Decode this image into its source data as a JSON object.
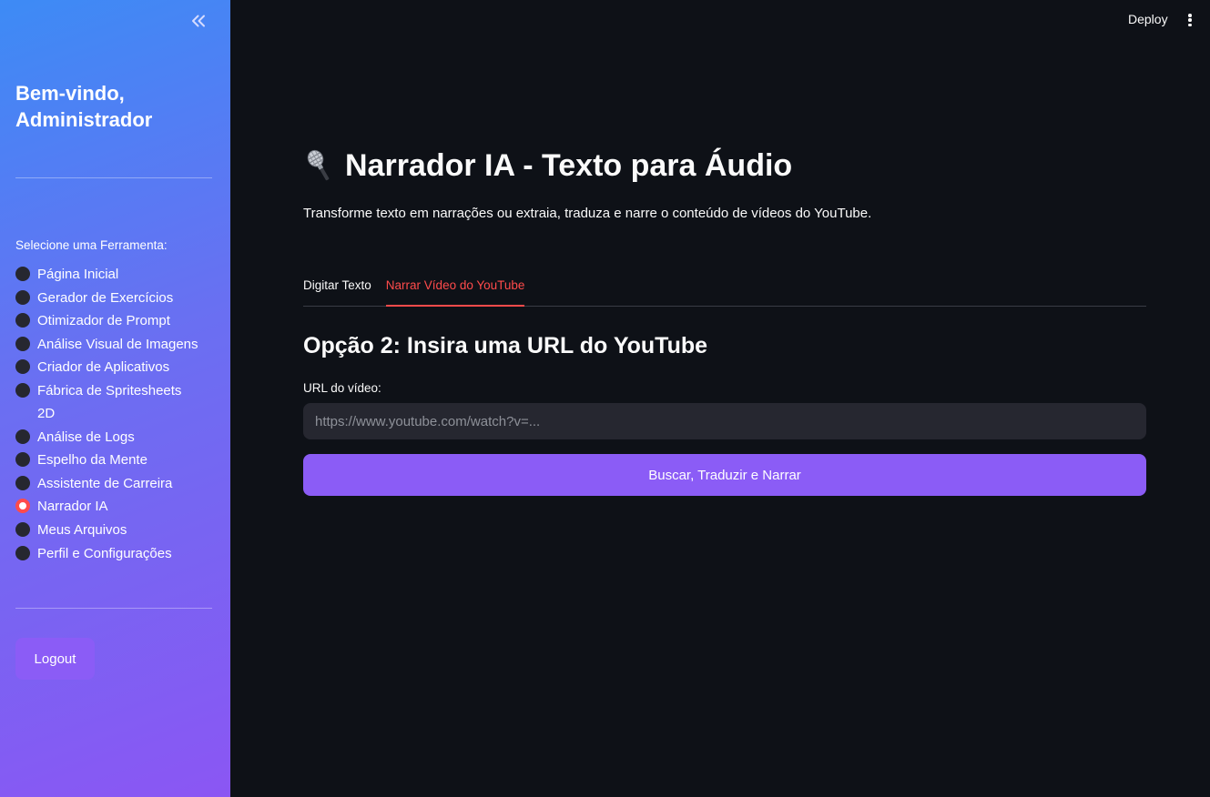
{
  "sidebar": {
    "welcome": "Bem-vindo, Administrador",
    "select_label": "Selecione uma Ferramenta:",
    "items": [
      {
        "label": "Página Inicial",
        "selected": false
      },
      {
        "label": "Gerador de Exercícios",
        "selected": false
      },
      {
        "label": "Otimizador de Prompt",
        "selected": false
      },
      {
        "label": "Análise Visual de Imagens",
        "selected": false
      },
      {
        "label": "Criador de Aplicativos",
        "selected": false
      },
      {
        "label": "Fábrica de Spritesheets 2D",
        "selected": false
      },
      {
        "label": "Análise de Logs",
        "selected": false
      },
      {
        "label": "Espelho da Mente",
        "selected": false
      },
      {
        "label": "Assistente de Carreira",
        "selected": false
      },
      {
        "label": "Narrador IA",
        "selected": true
      },
      {
        "label": "Meus Arquivos",
        "selected": false
      },
      {
        "label": "Perfil e Configurações",
        "selected": false
      }
    ],
    "logout_label": "Logout"
  },
  "header": {
    "deploy_label": "Deploy"
  },
  "main": {
    "title": "Narrador IA - Texto para Áudio",
    "subtitle": "Transforme texto em narrações ou extraia, traduza e narre o conteúdo de vídeos do YouTube.",
    "tabs": [
      {
        "label": "Digitar Texto",
        "active": false
      },
      {
        "label": "Narrar Vídeo do YouTube",
        "active": true
      }
    ],
    "section_title": "Opção 2: Insira uma URL do YouTube",
    "field_label": "URL do vídeo:",
    "url_placeholder": "https://www.youtube.com/watch?v=...",
    "url_value": "",
    "action_label": "Buscar, Traduzir e Narrar"
  },
  "colors": {
    "accent": "#ff4b4b",
    "button": "#8b5cf6",
    "background": "#0e1117",
    "sidebar_gradient_start": "#3d8bf5",
    "sidebar_gradient_end": "#8b56f3"
  },
  "icons": {
    "collapse": "double-chevron-left-icon",
    "title": "microphone-icon",
    "menu": "kebab-menu-icon"
  }
}
